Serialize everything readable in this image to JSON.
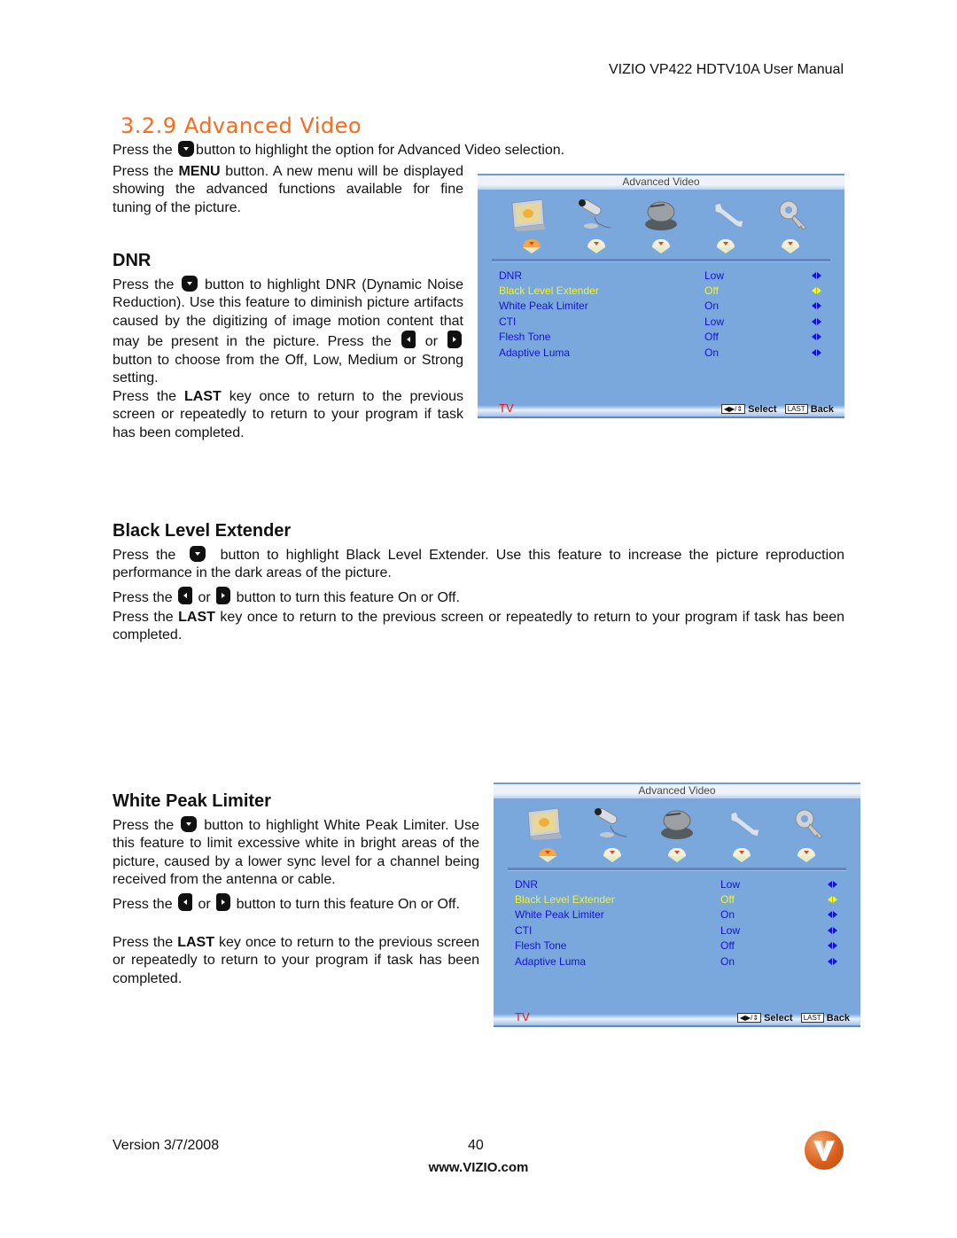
{
  "header": {
    "manual_title": "VIZIO VP422 HDTV10A User Manual"
  },
  "section": {
    "title": "3.2.9 Advanced Video",
    "intro_line": {
      "before": "Press the",
      "after": "button to highlight the option for Advanced Video selection."
    },
    "menu_para": {
      "before": "Press the",
      "bold": "MENU",
      "after": "button.  A new menu will be displayed showing the advanced functions available for fine tuning of the picture."
    }
  },
  "dnr": {
    "heading": "DNR",
    "p1_before": "Press the",
    "p1_after": "button to highlight DNR (Dynamic Noise Reduction).  Use this feature to diminish picture artifacts caused by the digitizing of image motion content that may be present in the picture. Press the",
    "p1_or": "or",
    "p1_end": "button to choose from the Off, Low, Medium or Strong setting.",
    "p2_before": "Press the",
    "p2_bold": "LAST",
    "p2_after": "key once to return to the previous screen or repeatedly to return to your program if task has been completed."
  },
  "ble": {
    "heading": "Black Level Extender",
    "p1_before": "Press the",
    "p1_after": "button to highlight Black Level Extender.  Use this feature to increase the picture reproduction performance in the dark areas of the picture.",
    "p2_before": "Press the",
    "p2_or": "or",
    "p2_after": "button to turn this feature On or Off.",
    "p3_before": "Press the",
    "p3_bold": "LAST",
    "p3_after": "key once to return to the previous screen or repeatedly to return to your program if task has been completed."
  },
  "wpl": {
    "heading": "White Peak Limiter",
    "p1_before": "Press the",
    "p1_after": "button to highlight White Peak Limiter. Use this feature to limit excessive white in bright areas of the picture, caused by a lower sync level for a channel being received from the antenna or cable.",
    "p2_before": "Press the",
    "p2_or": "or",
    "p2_after": "button to turn this feature On or Off.",
    "p3_before": "Press the",
    "p3_bold": "LAST",
    "p3_after": "key once to return to the previous screen or repeatedly to return to your program if task has been completed."
  },
  "osd": {
    "title": "Advanced Video",
    "icons": [
      "monitor-icon",
      "camera-icon",
      "satellite-dish-icon",
      "wrench-icon",
      "key-icon"
    ],
    "rows": [
      {
        "label": "DNR",
        "value": "Low",
        "selected": false
      },
      {
        "label": "Black Level Extender",
        "value": "Off",
        "selected": true
      },
      {
        "label": "White Peak Limiter",
        "value": "On",
        "selected": false
      },
      {
        "label": "CTI",
        "value": "Low",
        "selected": false
      },
      {
        "label": "Flesh Tone",
        "value": "Off",
        "selected": false
      },
      {
        "label": "Adaptive Luma",
        "value": "On",
        "selected": false
      }
    ],
    "source": "TV",
    "select_key": "◀▶/⇕",
    "select_label": "Select",
    "back_key": "LAST",
    "back_label": "Back",
    "colors": {
      "background": "#7aa7dc",
      "text": "#1414d8",
      "highlight": "#f4f41e",
      "source": "#ee1111"
    }
  },
  "footer": {
    "version": "Version 3/7/2008",
    "page": "40",
    "url": "www.VIZIO.com",
    "logo_letter": "V"
  },
  "colors": {
    "section_title": "#ff6a1a",
    "logo": "#d9601c"
  }
}
